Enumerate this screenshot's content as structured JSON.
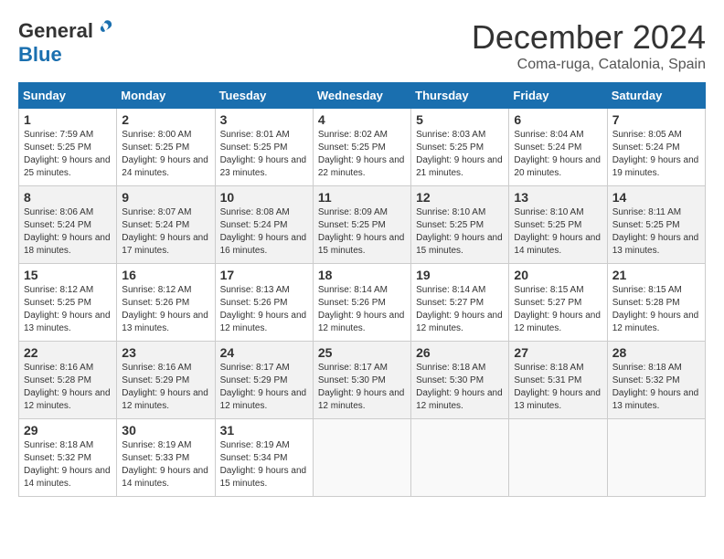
{
  "logo": {
    "general": "General",
    "blue": "Blue"
  },
  "title": {
    "month_year": "December 2024",
    "location": "Coma-ruga, Catalonia, Spain"
  },
  "days_of_week": [
    "Sunday",
    "Monday",
    "Tuesday",
    "Wednesday",
    "Thursday",
    "Friday",
    "Saturday"
  ],
  "weeks": [
    [
      {
        "day": "1",
        "sunrise": "Sunrise: 7:59 AM",
        "sunset": "Sunset: 5:25 PM",
        "daylight": "Daylight: 9 hours and 25 minutes."
      },
      {
        "day": "2",
        "sunrise": "Sunrise: 8:00 AM",
        "sunset": "Sunset: 5:25 PM",
        "daylight": "Daylight: 9 hours and 24 minutes."
      },
      {
        "day": "3",
        "sunrise": "Sunrise: 8:01 AM",
        "sunset": "Sunset: 5:25 PM",
        "daylight": "Daylight: 9 hours and 23 minutes."
      },
      {
        "day": "4",
        "sunrise": "Sunrise: 8:02 AM",
        "sunset": "Sunset: 5:25 PM",
        "daylight": "Daylight: 9 hours and 22 minutes."
      },
      {
        "day": "5",
        "sunrise": "Sunrise: 8:03 AM",
        "sunset": "Sunset: 5:25 PM",
        "daylight": "Daylight: 9 hours and 21 minutes."
      },
      {
        "day": "6",
        "sunrise": "Sunrise: 8:04 AM",
        "sunset": "Sunset: 5:24 PM",
        "daylight": "Daylight: 9 hours and 20 minutes."
      },
      {
        "day": "7",
        "sunrise": "Sunrise: 8:05 AM",
        "sunset": "Sunset: 5:24 PM",
        "daylight": "Daylight: 9 hours and 19 minutes."
      }
    ],
    [
      {
        "day": "8",
        "sunrise": "Sunrise: 8:06 AM",
        "sunset": "Sunset: 5:24 PM",
        "daylight": "Daylight: 9 hours and 18 minutes."
      },
      {
        "day": "9",
        "sunrise": "Sunrise: 8:07 AM",
        "sunset": "Sunset: 5:24 PM",
        "daylight": "Daylight: 9 hours and 17 minutes."
      },
      {
        "day": "10",
        "sunrise": "Sunrise: 8:08 AM",
        "sunset": "Sunset: 5:24 PM",
        "daylight": "Daylight: 9 hours and 16 minutes."
      },
      {
        "day": "11",
        "sunrise": "Sunrise: 8:09 AM",
        "sunset": "Sunset: 5:25 PM",
        "daylight": "Daylight: 9 hours and 15 minutes."
      },
      {
        "day": "12",
        "sunrise": "Sunrise: 8:10 AM",
        "sunset": "Sunset: 5:25 PM",
        "daylight": "Daylight: 9 hours and 15 minutes."
      },
      {
        "day": "13",
        "sunrise": "Sunrise: 8:10 AM",
        "sunset": "Sunset: 5:25 PM",
        "daylight": "Daylight: 9 hours and 14 minutes."
      },
      {
        "day": "14",
        "sunrise": "Sunrise: 8:11 AM",
        "sunset": "Sunset: 5:25 PM",
        "daylight": "Daylight: 9 hours and 13 minutes."
      }
    ],
    [
      {
        "day": "15",
        "sunrise": "Sunrise: 8:12 AM",
        "sunset": "Sunset: 5:25 PM",
        "daylight": "Daylight: 9 hours and 13 minutes."
      },
      {
        "day": "16",
        "sunrise": "Sunrise: 8:12 AM",
        "sunset": "Sunset: 5:26 PM",
        "daylight": "Daylight: 9 hours and 13 minutes."
      },
      {
        "day": "17",
        "sunrise": "Sunrise: 8:13 AM",
        "sunset": "Sunset: 5:26 PM",
        "daylight": "Daylight: 9 hours and 12 minutes."
      },
      {
        "day": "18",
        "sunrise": "Sunrise: 8:14 AM",
        "sunset": "Sunset: 5:26 PM",
        "daylight": "Daylight: 9 hours and 12 minutes."
      },
      {
        "day": "19",
        "sunrise": "Sunrise: 8:14 AM",
        "sunset": "Sunset: 5:27 PM",
        "daylight": "Daylight: 9 hours and 12 minutes."
      },
      {
        "day": "20",
        "sunrise": "Sunrise: 8:15 AM",
        "sunset": "Sunset: 5:27 PM",
        "daylight": "Daylight: 9 hours and 12 minutes."
      },
      {
        "day": "21",
        "sunrise": "Sunrise: 8:15 AM",
        "sunset": "Sunset: 5:28 PM",
        "daylight": "Daylight: 9 hours and 12 minutes."
      }
    ],
    [
      {
        "day": "22",
        "sunrise": "Sunrise: 8:16 AM",
        "sunset": "Sunset: 5:28 PM",
        "daylight": "Daylight: 9 hours and 12 minutes."
      },
      {
        "day": "23",
        "sunrise": "Sunrise: 8:16 AM",
        "sunset": "Sunset: 5:29 PM",
        "daylight": "Daylight: 9 hours and 12 minutes."
      },
      {
        "day": "24",
        "sunrise": "Sunrise: 8:17 AM",
        "sunset": "Sunset: 5:29 PM",
        "daylight": "Daylight: 9 hours and 12 minutes."
      },
      {
        "day": "25",
        "sunrise": "Sunrise: 8:17 AM",
        "sunset": "Sunset: 5:30 PM",
        "daylight": "Daylight: 9 hours and 12 minutes."
      },
      {
        "day": "26",
        "sunrise": "Sunrise: 8:18 AM",
        "sunset": "Sunset: 5:30 PM",
        "daylight": "Daylight: 9 hours and 12 minutes."
      },
      {
        "day": "27",
        "sunrise": "Sunrise: 8:18 AM",
        "sunset": "Sunset: 5:31 PM",
        "daylight": "Daylight: 9 hours and 13 minutes."
      },
      {
        "day": "28",
        "sunrise": "Sunrise: 8:18 AM",
        "sunset": "Sunset: 5:32 PM",
        "daylight": "Daylight: 9 hours and 13 minutes."
      }
    ],
    [
      {
        "day": "29",
        "sunrise": "Sunrise: 8:18 AM",
        "sunset": "Sunset: 5:32 PM",
        "daylight": "Daylight: 9 hours and 14 minutes."
      },
      {
        "day": "30",
        "sunrise": "Sunrise: 8:19 AM",
        "sunset": "Sunset: 5:33 PM",
        "daylight": "Daylight: 9 hours and 14 minutes."
      },
      {
        "day": "31",
        "sunrise": "Sunrise: 8:19 AM",
        "sunset": "Sunset: 5:34 PM",
        "daylight": "Daylight: 9 hours and 15 minutes."
      },
      null,
      null,
      null,
      null
    ]
  ]
}
